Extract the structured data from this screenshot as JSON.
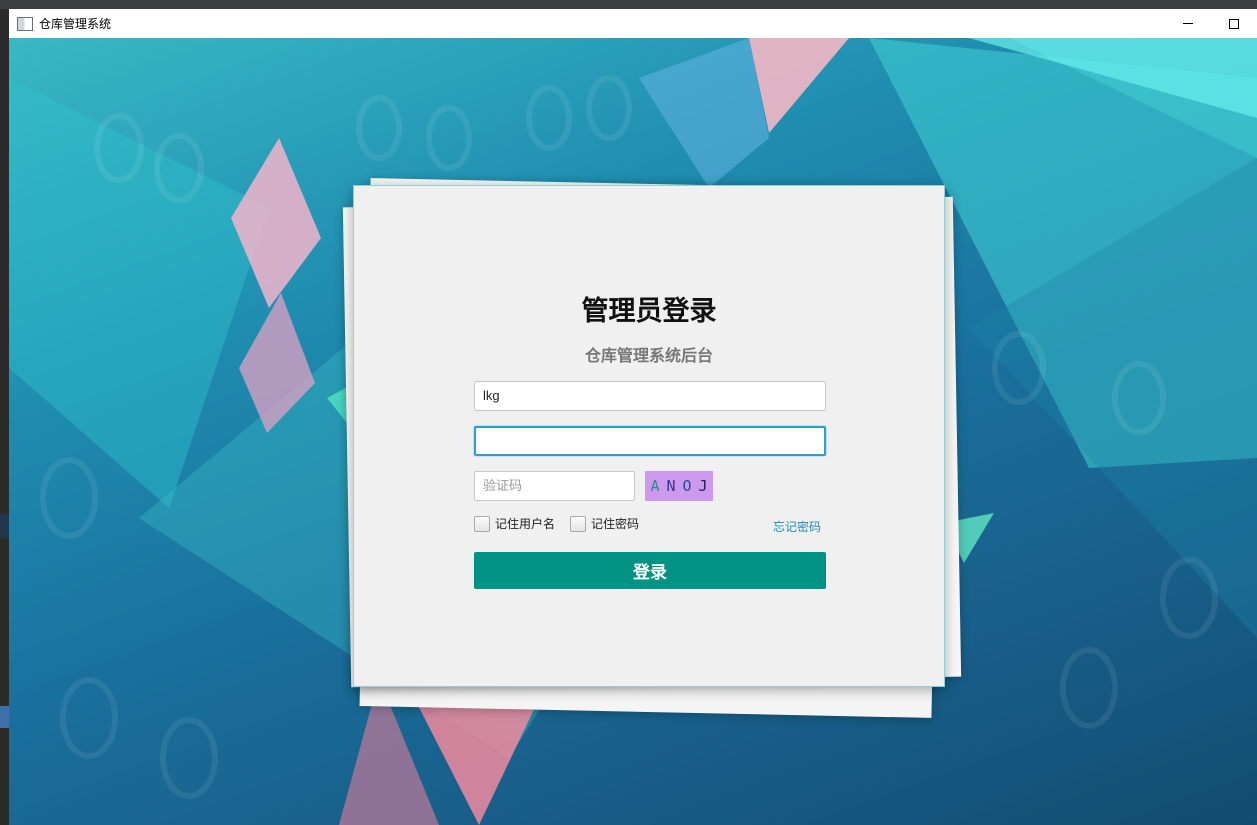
{
  "window": {
    "title": "仓库管理系统",
    "minimize_icon": "minimize-icon",
    "maximize_icon": "maximize-icon"
  },
  "login": {
    "heading": "管理员登录",
    "subheading": "仓库管理系统后台",
    "username_value": "lkg",
    "password_value": "",
    "captcha_placeholder": "验证码",
    "captcha_chars": [
      "A",
      "N",
      "O",
      "J"
    ],
    "remember_username_label": "记住用户名",
    "remember_password_label": "记住密码",
    "forgot_password_label": "忘记密码",
    "login_button_label": "登录"
  },
  "colors": {
    "login_button": "#009384",
    "link": "#1a8fb4",
    "captcha_bg": "#cc99ee",
    "focus_border": "#2a9fd6"
  }
}
